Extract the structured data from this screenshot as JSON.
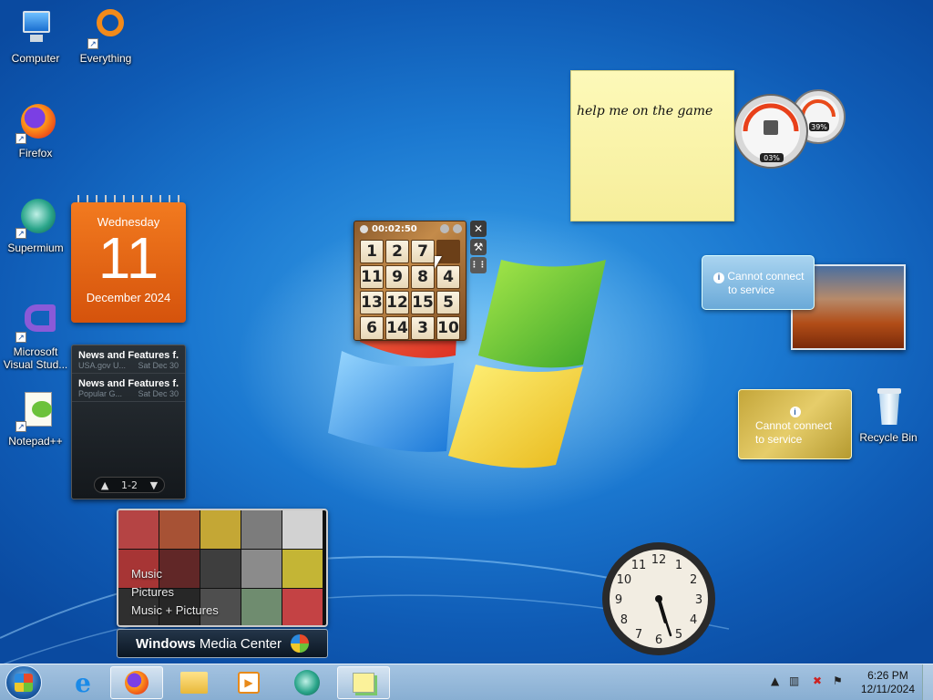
{
  "desktop_icons": [
    {
      "label": "Computer",
      "icon": "computer-icon"
    },
    {
      "label": "Everything",
      "icon": "everything-icon"
    },
    {
      "label": "Firefox",
      "icon": "firefox-icon"
    },
    {
      "label": "Supermium",
      "icon": "supermium-icon"
    },
    {
      "label": "Microsoft Visual Stud...",
      "icon": "visual-studio-icon"
    },
    {
      "label": "Notepad++",
      "icon": "notepadpp-icon"
    },
    {
      "label": "Recycle Bin",
      "icon": "recycle-bin-icon"
    }
  ],
  "calendar": {
    "weekday": "Wednesday",
    "day": "11",
    "month_year": "December 2024"
  },
  "feed": {
    "items": [
      {
        "title": "News and Features f...",
        "source": "USA.gov U...",
        "date": "Sat Dec 30"
      },
      {
        "title": "News and Features f...",
        "source": "Popular G...",
        "date": "Sat Dec 30"
      }
    ],
    "page": "1-2"
  },
  "media_center": {
    "menu": [
      "Music",
      "Pictures",
      "Music + Pictures"
    ],
    "brand_bold": "Windows",
    "brand_rest": " Media Center"
  },
  "puzzle": {
    "timer": "00:02:50",
    "tiles": [
      "1",
      "2",
      "7",
      "",
      "11",
      "9",
      "8",
      "4",
      "13",
      "12",
      "15",
      "5",
      "6",
      "14",
      "3",
      "10"
    ]
  },
  "sticky_note": {
    "text": "help me on the game"
  },
  "cpu_meter": {
    "cpu": "03%",
    "memory": "39%"
  },
  "weather1": {
    "message_line1": "Cannot connect",
    "message_line2": "to service"
  },
  "weather2": {
    "message_line1": "Cannot connect",
    "message_line2": "to service"
  },
  "clock": {
    "numbers": [
      "12",
      "1",
      "2",
      "3",
      "4",
      "5",
      "6",
      "7",
      "8",
      "9",
      "10",
      "11"
    ],
    "hour": 5,
    "minute": 27
  },
  "taskbar": {
    "time": "6:26 PM",
    "date": "12/11/2024"
  },
  "colors": {
    "calendar_orange": "#e6661a",
    "sticky": "#fbf6ae",
    "taskbar": "#b8d3ea"
  }
}
